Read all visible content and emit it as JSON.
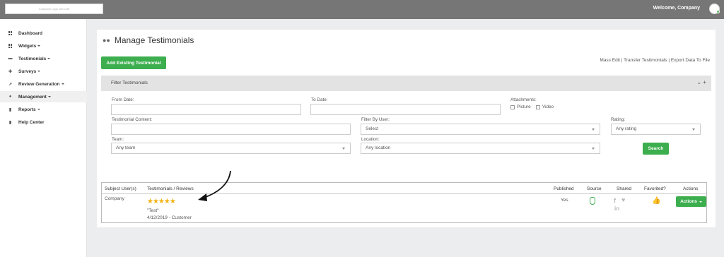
{
  "topbar": {
    "logo_text": "Company Logo 100 x 80",
    "welcome": "Welcome, Company"
  },
  "sidebar": {
    "items": [
      {
        "label": "Dashboard",
        "icon": "grid-icon",
        "caret": false
      },
      {
        "label": "Widgets",
        "icon": "grid-icon",
        "caret": true
      },
      {
        "label": "Testimonials",
        "icon": "comment-icon",
        "caret": true
      },
      {
        "label": "Surveys",
        "icon": "puzzle-icon",
        "caret": true
      },
      {
        "label": "Review Generation",
        "icon": "share-icon",
        "caret": true
      },
      {
        "label": "Management",
        "icon": "globe-icon",
        "caret": true,
        "active": true
      },
      {
        "label": "Reports",
        "icon": "file-icon",
        "caret": true
      },
      {
        "label": "Help Center",
        "icon": "book-icon",
        "caret": false
      }
    ]
  },
  "main": {
    "title": "Manage Testimonials",
    "add_button": "Add Existing Testimonial",
    "links": "Mass Edit | Transfer Testimonials | Export Data To File"
  },
  "filter": {
    "title": "Filter Testimonials",
    "from_date_label": "From Date:",
    "to_date_label": "To Date:",
    "attachments_label": "Attachments:",
    "picture_label": "Picture",
    "video_label": "Video",
    "content_label": "Testimonial Content:",
    "user_label": "Filter By User:",
    "user_value": "Select",
    "rating_label": "Rating:",
    "rating_value": "Any rating",
    "team_label": "Team:",
    "team_value": "Any team",
    "location_label": "Location:",
    "location_value": "Any location",
    "search_button": "Search"
  },
  "table": {
    "headers": [
      "Subject User(s)",
      "Testimonials / Reviews",
      "Published",
      "Source",
      "Shared",
      "Favorited?",
      "Actions"
    ],
    "rows": [
      {
        "subject": "Company",
        "stars": "★★★★★",
        "rating": 5,
        "text": "\"Test\"",
        "meta": "4/12/2019 - Customer",
        "published": "Yes",
        "source_icon": "hand-icon",
        "actions_label": "Actions"
      }
    ]
  },
  "colors": {
    "accent_green": "#3cae4e",
    "topbar": "#767676",
    "star": "#f2b10f"
  }
}
